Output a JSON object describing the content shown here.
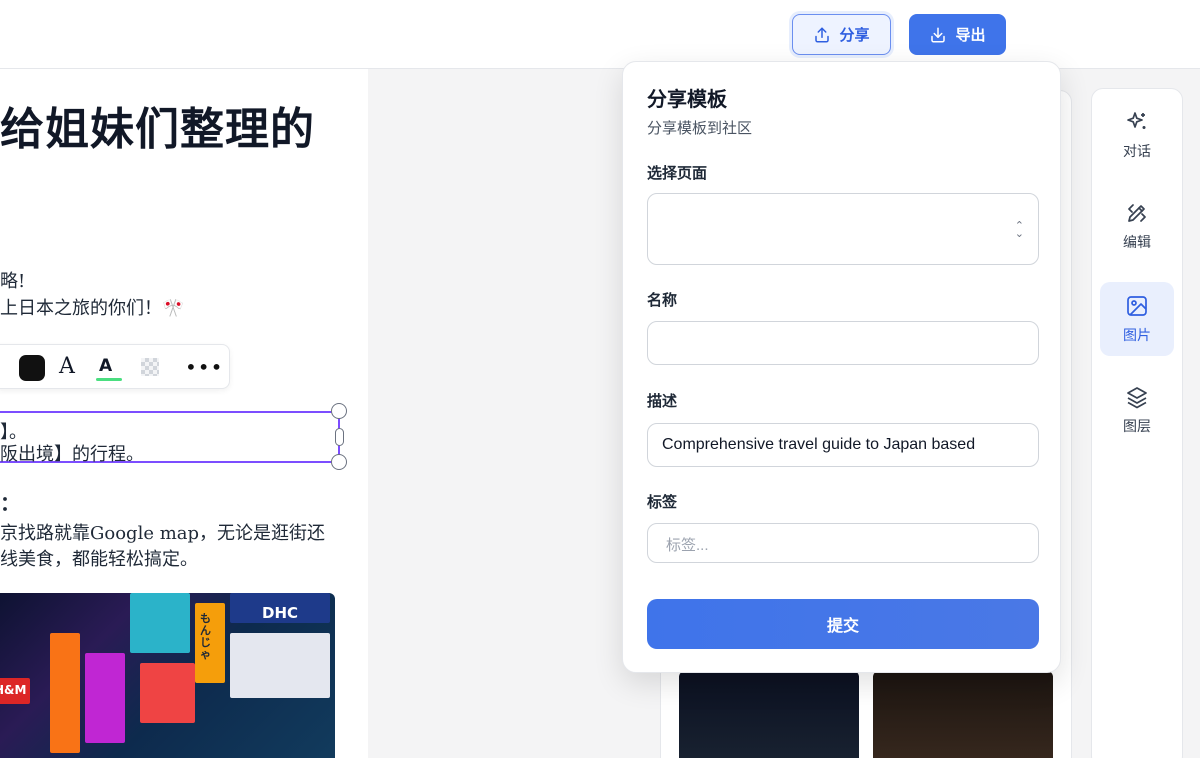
{
  "toolbar": {
    "share_label": "分享",
    "export_label": "导出"
  },
  "document": {
    "title": "给姐妹们整理的",
    "lines": [
      "略!",
      "上日本之旅的你们！🎌",
      "】。",
      "阪出境】的行程。",
      "：",
      "京找路就靠Google map，无论是逛街还",
      "线美食，都能轻松搞定。"
    ],
    "format_toolbar": {
      "font_glyph": "A",
      "color_glyph": "A",
      "more_glyph": "•••"
    },
    "photo_signs": [
      "DHC",
      "H&M",
      "もんじゃ"
    ]
  },
  "rail": {
    "items": [
      {
        "label": "对话",
        "icon": "sparkles-icon"
      },
      {
        "label": "编辑",
        "icon": "pencil-ruler-icon"
      },
      {
        "label": "图片",
        "icon": "image-icon",
        "active": true
      },
      {
        "label": "图层",
        "icon": "layers-icon"
      }
    ]
  },
  "modal": {
    "title": "分享模板",
    "subtitle": "分享模板到社区",
    "page_label": "选择页面",
    "name_label": "名称",
    "name_value": "",
    "description_label": "描述",
    "description_value": "Comprehensive travel guide to Japan based",
    "tags_label": "标签",
    "tags_placeholder": "标签...",
    "submit_label": "提交"
  },
  "colors": {
    "accent": "#3f74ea",
    "active_bg": "#e9effd",
    "selection": "#7c4dff"
  }
}
